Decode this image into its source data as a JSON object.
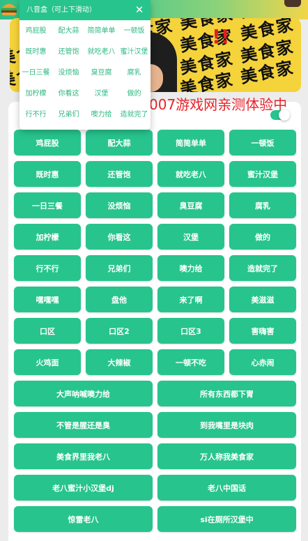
{
  "colors": {
    "accent": "#27c48e",
    "marquee": "#e8232a",
    "banner": "#f5d33b"
  },
  "banner": {
    "stripe_text": "美食家 美食家 美食家 美食家 美食家",
    "exclaim": "!!"
  },
  "marquee_text": "007游戏网亲测体验中",
  "panel": {
    "title": "八音盒（可上下滑动）",
    "close_icon": "close-icon",
    "items": [
      "鸡屁股",
      "配大蒜",
      "简简单单",
      "一顿饭",
      "既时惠",
      "还管饱",
      "就吃老八",
      "蜜汁汉堡",
      "一日三餐",
      "没烦恼",
      "臭豆腐",
      "腐乳",
      "加柠檬",
      "你看这",
      "汉堡",
      "做的",
      "行不行",
      "兄弟们",
      "噢力给",
      "造就完了"
    ]
  },
  "grid_small": [
    "鸡屁股",
    "配大蒜",
    "简简单单",
    "一顿饭",
    "既时惠",
    "还管饱",
    "就吃老八",
    "蜜汁汉堡",
    "一日三餐",
    "没烦恼",
    "臭豆腐",
    "腐乳",
    "加柠檬",
    "你看这",
    "汉堡",
    "做的",
    "行不行",
    "兄弟们",
    "噢力给",
    "造就完了",
    "嘿嘿嘿",
    "盘他",
    "来了啊",
    "美滋滋",
    "口区",
    "口区2",
    "口区3",
    "害嗨害",
    "火鸡面",
    "大辣椒",
    "一顿不吃",
    "心赤闹"
  ],
  "grid_wide": [
    "大声呐喊噢力给",
    "所有东西都下胃",
    "不管是腥还是臭",
    "到我嘴里是块肉",
    "美食界里我老八",
    "万人称我美食家",
    "老八蜜汁小汉堡dj",
    "老八中国话",
    "惊雷老八",
    "si在厕所汉堡中"
  ]
}
